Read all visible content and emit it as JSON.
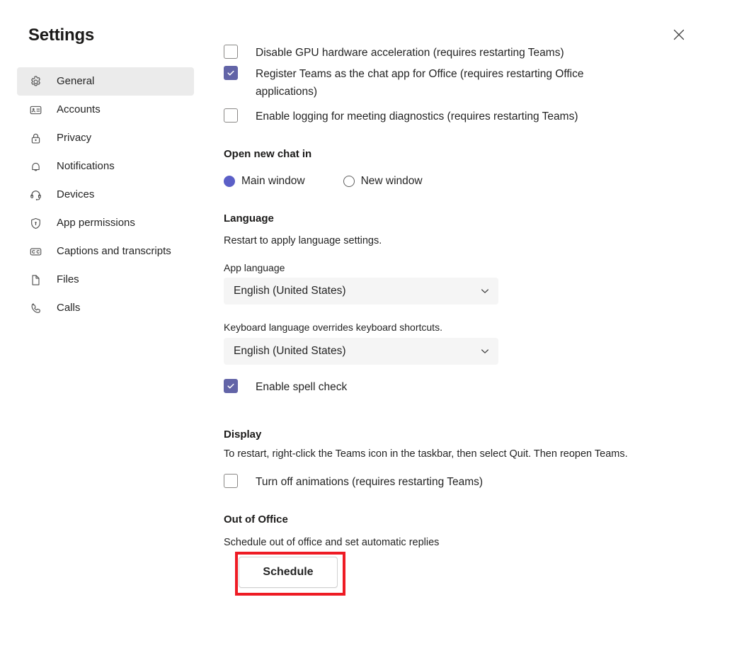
{
  "window": {
    "title": "Settings",
    "close_icon": "close-icon"
  },
  "theme": {
    "accent": "#6264A7",
    "radio_accent": "#5B5FC7",
    "selected_nav_bg": "#EBEBEB",
    "field_bg": "#F5F5F5",
    "highlight_border": "#EE1B24",
    "text": "#242424"
  },
  "sidebar": {
    "items": [
      {
        "label": "General",
        "icon": "gear-icon",
        "selected": true
      },
      {
        "label": "Accounts",
        "icon": "contact-card-icon",
        "selected": false
      },
      {
        "label": "Privacy",
        "icon": "lock-icon",
        "selected": false
      },
      {
        "label": "Notifications",
        "icon": "bell-icon",
        "selected": false
      },
      {
        "label": "Devices",
        "icon": "headset-icon",
        "selected": false
      },
      {
        "label": "App permissions",
        "icon": "shield-icon",
        "selected": false
      },
      {
        "label": "Captions and transcripts",
        "icon": "closed-caption-icon",
        "selected": false
      },
      {
        "label": "Files",
        "icon": "file-icon",
        "selected": false
      },
      {
        "label": "Calls",
        "icon": "phone-icon",
        "selected": false
      }
    ]
  },
  "main": {
    "clipped_checkbox": {
      "label": "Disable GPU hardware acceleration (requires restarting Teams)",
      "checked": false
    },
    "checkboxes_top": [
      {
        "label": "Register Teams as the chat app for Office (requires restarting Office applications)",
        "checked": true
      },
      {
        "label": "Enable logging for meeting diagnostics (requires restarting Teams)",
        "checked": false
      }
    ],
    "open_new_chat": {
      "heading": "Open new chat in",
      "options": [
        {
          "label": "Main window",
          "selected": true
        },
        {
          "label": "New window",
          "selected": false
        }
      ]
    },
    "language": {
      "heading": "Language",
      "subtitle": "Restart to apply language settings.",
      "app_language_label": "App language",
      "app_language_value": "English (United States)",
      "keyboard_language_label": "Keyboard language overrides keyboard shortcuts.",
      "keyboard_language_value": "English (United States)",
      "spell_check": {
        "label": "Enable spell check",
        "checked": true
      }
    },
    "display": {
      "heading": "Display",
      "subtitle": "To restart, right-click the Teams icon in the taskbar, then select Quit. Then reopen Teams.",
      "turn_off_animations": {
        "label": "Turn off animations (requires restarting Teams)",
        "checked": false
      }
    },
    "out_of_office": {
      "heading": "Out of Office",
      "subtitle": "Schedule out of office and set automatic replies",
      "schedule_button": "Schedule",
      "highlighted": true
    }
  }
}
